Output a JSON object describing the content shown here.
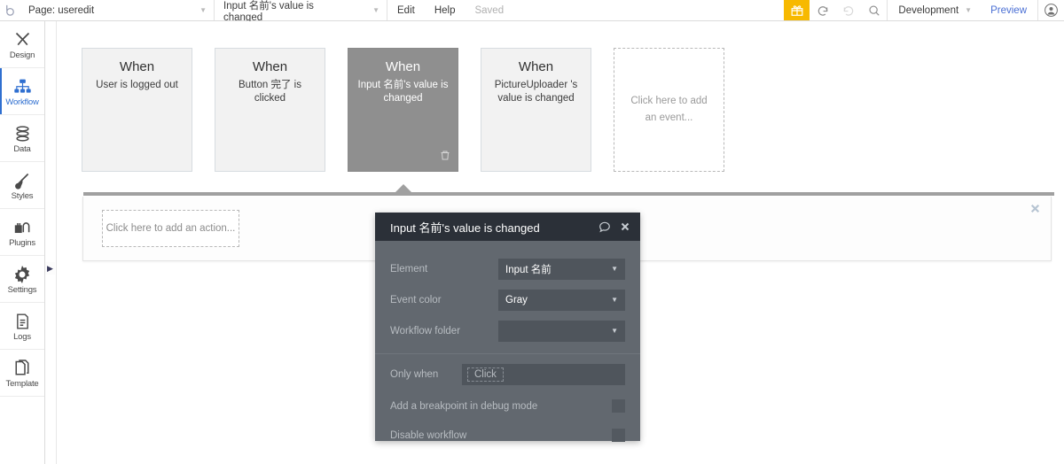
{
  "topbar": {
    "logo_icon": "bubble-logo-icon",
    "page_selector": {
      "label": "Page: useredit",
      "caret": "▼"
    },
    "workflow_selector": {
      "label": "Input 名前's value is changed",
      "caret": "▼"
    },
    "edit_label": "Edit",
    "help_label": "Help",
    "saved_label": "Saved",
    "gift_icon": "gift-icon",
    "undo_icon": "undo-icon",
    "redo_icon": "redo-icon",
    "search_icon": "search-icon",
    "environment": {
      "label": "Development",
      "caret": "▼"
    },
    "preview_label": "Preview",
    "account_icon": "user-avatar-icon",
    "accent_color": "#f7b900",
    "link_color": "#4a6fd4"
  },
  "sidebar": {
    "items": [
      {
        "label": "Design",
        "icon": "design-tools-icon",
        "active": false
      },
      {
        "label": "Workflow",
        "icon": "workflow-nodes-icon",
        "active": true
      },
      {
        "label": "Data",
        "icon": "database-icon",
        "active": false
      },
      {
        "label": "Styles",
        "icon": "paintbrush-icon",
        "active": false
      },
      {
        "label": "Plugins",
        "icon": "plugins-icon",
        "active": false
      },
      {
        "label": "Settings",
        "icon": "gear-icon",
        "active": false
      },
      {
        "label": "Logs",
        "icon": "document-lines-icon",
        "active": false
      },
      {
        "label": "Template",
        "icon": "template-pages-icon",
        "active": false
      }
    ],
    "expand_icon": "▶",
    "active_color": "#2f6fd0"
  },
  "canvas": {
    "events": [
      {
        "when": "When",
        "desc": "User is logged out",
        "selected": false,
        "placeholder": false
      },
      {
        "when": "When",
        "desc": "Button 完了 is clicked",
        "selected": false,
        "placeholder": false
      },
      {
        "when": "When",
        "desc": "Input 名前's value is changed",
        "selected": true,
        "placeholder": false,
        "trash_icon": "trash-icon"
      },
      {
        "when": "When",
        "desc": "PictureUploader 's value is changed",
        "selected": false,
        "placeholder": false
      },
      {
        "when": "",
        "desc": "Click here to add an event...",
        "selected": false,
        "placeholder": true
      }
    ],
    "add_action_label": "Click here to add an action...",
    "panel_close_icon": "close-icon",
    "selected_color": "#8f8f8f"
  },
  "dialog": {
    "title": "Input 名前's value is changed",
    "comment_icon": "comment-bubble-icon",
    "close_icon": "close-icon",
    "rows": [
      {
        "label": "Element",
        "value": "Input 名前",
        "caret": "▼"
      },
      {
        "label": "Event color",
        "value": "Gray",
        "caret": "▼"
      },
      {
        "label": "Workflow folder",
        "value": "",
        "caret": "▼"
      }
    ],
    "only_when": {
      "label": "Only when",
      "chip": "Click"
    },
    "checkboxes": [
      {
        "label": "Add a breakpoint in debug mode",
        "checked": false
      },
      {
        "label": "Disable workflow",
        "checked": false
      }
    ],
    "header_color": "#2b3038",
    "body_color": "#62686f"
  }
}
